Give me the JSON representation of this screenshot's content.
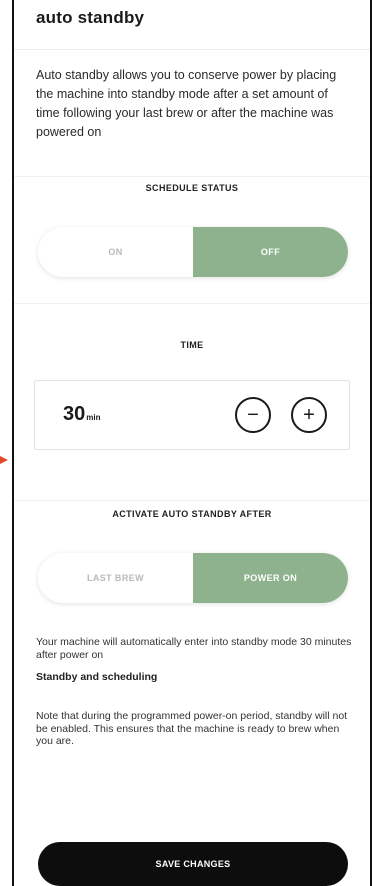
{
  "header": {
    "title": "auto standby"
  },
  "intro": {
    "text": "Auto standby allows you to conserve power by placing the machine into standby mode after a set amount of time following your last brew or after the machine was powered on"
  },
  "schedule_status": {
    "heading": "SCHEDULE STATUS",
    "options": [
      {
        "label": "ON",
        "selected": false
      },
      {
        "label": "OFF",
        "selected": true
      }
    ]
  },
  "time": {
    "heading": "TIME",
    "value": "30",
    "unit": "min",
    "decrement_label": "−",
    "increment_label": "+"
  },
  "activate_after": {
    "heading": "ACTIVATE AUTO STANDBY AFTER",
    "options": [
      {
        "label": "LAST BREW",
        "selected": false
      },
      {
        "label": "POWER ON",
        "selected": true
      }
    ]
  },
  "description": "Your machine will automatically enter into standby mode 30 minutes after power on",
  "standby_scheduling": {
    "heading": "Standby and scheduling",
    "note": "Note that during the programmed power-on period, standby will not be enabled. This ensures that the machine is ready to brew when you are."
  },
  "footer": {
    "save_label": "SAVE CHANGES"
  },
  "colors": {
    "accent_green": "#8db28d",
    "primary_button": "#0d0d0d",
    "edge_marker": "#e3482d"
  }
}
